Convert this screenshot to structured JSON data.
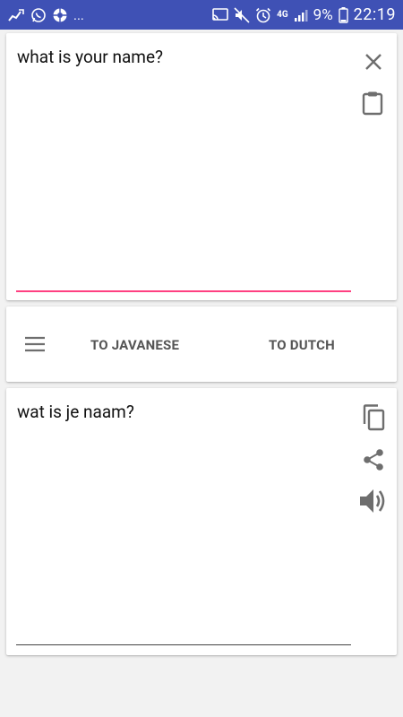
{
  "status_bar": {
    "left_icons": [
      "usb-tether-icon",
      "whatsapp-icon",
      "aperture-icon"
    ],
    "more_indicator": "...",
    "right_icons": [
      "cast-icon",
      "mute-icon",
      "alarm-icon",
      "network-4g-icon",
      "signal-icon",
      "battery-icon"
    ],
    "battery_percent": "9%",
    "time": "22:19",
    "network_label": "4G",
    "background": "#3f51b5"
  },
  "source": {
    "text": "what is your name?",
    "icons": [
      "close-icon",
      "clipboard-icon"
    ],
    "underline_color": "#ff4081"
  },
  "toolbar": {
    "menu_icon": "menu-icon",
    "to_javanese": "TO JAVANESE",
    "to_dutch": "TO DUTCH"
  },
  "result": {
    "text": "wat is je naam?",
    "icons": [
      "copy-icon",
      "share-icon",
      "speaker-icon"
    ]
  }
}
